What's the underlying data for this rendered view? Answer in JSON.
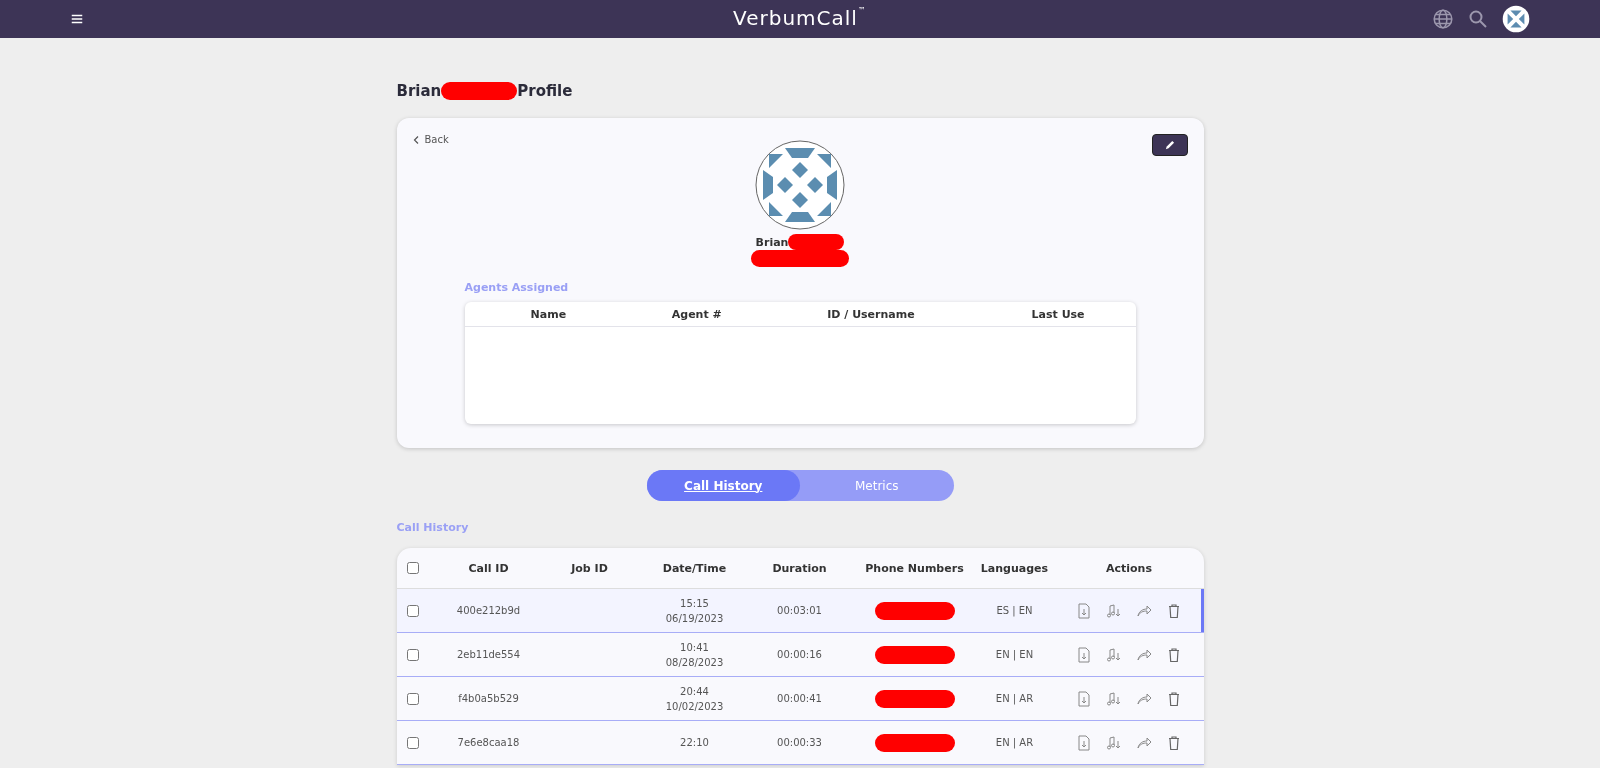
{
  "header": {
    "logo": "VerbumCall",
    "logo_mark": "™"
  },
  "page_title": {
    "first": "Brian",
    "last": "Profile"
  },
  "profile": {
    "back": "Back",
    "name": "Brian"
  },
  "agents": {
    "title": "Agents Assigned",
    "columns": [
      "Name",
      "Agent #",
      "ID / Username",
      "Last Use"
    ]
  },
  "tabs": [
    {
      "label": "Call History",
      "selected": true
    },
    {
      "label": "Metrics",
      "selected": false
    }
  ],
  "call_history": {
    "title": "Call History",
    "header_checked": false,
    "columns": [
      "Call ID",
      "Job ID",
      "Date/Time",
      "Duration",
      "Phone Numbers",
      "Languages",
      "Actions"
    ],
    "rows": [
      {
        "call_id": "400e212b9d",
        "time": "15:15",
        "date": "06/19/2023",
        "duration": "00:03:01",
        "languages": "ES | EN",
        "checked": false,
        "selected": true
      },
      {
        "call_id": "2eb11de554",
        "time": "10:41",
        "date": "08/28/2023",
        "duration": "00:00:16",
        "languages": "EN | EN",
        "checked": false,
        "selected": false
      },
      {
        "call_id": "f4b0a5b529",
        "time": "20:44",
        "date": "10/02/2023",
        "duration": "00:00:41",
        "languages": "EN | AR",
        "checked": false,
        "selected": false
      },
      {
        "call_id": "7e6e8caa18",
        "time": "22:10",
        "duration": "00:00:33",
        "languages": "EN | AR",
        "checked": false,
        "selected": false
      }
    ]
  }
}
